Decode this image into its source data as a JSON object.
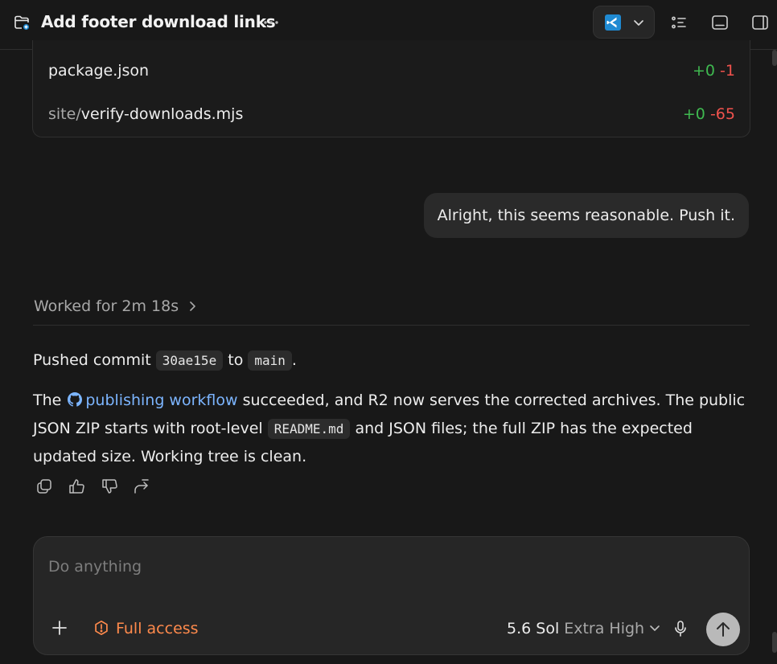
{
  "header": {
    "title": "Add footer download links",
    "more_icon": "ellipsis-icon",
    "editor_icon": "vscode-icon",
    "icons": [
      "checklist-icon",
      "terminal-panel-icon",
      "sidebar-panel-icon"
    ]
  },
  "files": [
    {
      "dir": "",
      "name": "package.json",
      "additions": "+0",
      "deletions": "-1"
    },
    {
      "dir": "site/",
      "name": "verify-downloads.mjs",
      "additions": "+0",
      "deletions": "-65"
    }
  ],
  "user_message": "Alright, this seems reasonable. Push it.",
  "worked_label": "Worked for 2m 18s",
  "response": {
    "p1_a": "Pushed commit",
    "commit": "30ae15e",
    "p1_b": "to",
    "branch": "main",
    "p1_c": ".",
    "p2_a": "The",
    "link_text": "publishing workflow",
    "p2_b": "succeeded, and R2 now serves the corrected archives. The public JSON ZIP starts with root-level",
    "readme": "README.md",
    "p2_c": "and JSON files; the full ZIP has the expected updated size. Working tree is clean."
  },
  "actions": [
    "copy-icon",
    "thumbs-up-icon",
    "thumbs-down-icon",
    "share-icon"
  ],
  "composer": {
    "placeholder": "Do anything",
    "access_label": "Full access",
    "model_name": "5.6 Sol",
    "effort": "Extra High"
  },
  "colors": {
    "background": "#181818",
    "addition": "#3fb950",
    "deletion": "#f0524d",
    "link": "#7cb5ff",
    "access_warning": "#ff8a4c",
    "vscode_blue": "#1f8ad2"
  }
}
